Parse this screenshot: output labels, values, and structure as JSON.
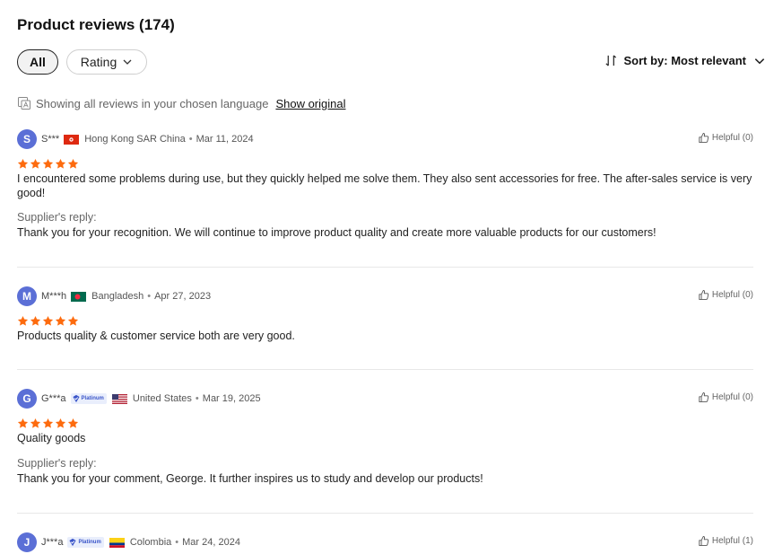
{
  "header": {
    "title": "Product reviews (174)"
  },
  "filters": {
    "all_label": "All",
    "rating_label": "Rating"
  },
  "sort": {
    "label": "Sort by: Most relevant"
  },
  "language": {
    "notice": "Showing all reviews in your chosen language",
    "show_original": "Show original"
  },
  "colors": {
    "star": "#fd6b0e",
    "avatar": "#5b6fd6",
    "text": "#222222",
    "muted": "#666666",
    "divider": "#e8e8e8"
  },
  "reviews": [
    {
      "initial": "S",
      "user": "S***",
      "country": "Hong Kong SAR China",
      "date": "Mar 11, 2024",
      "helpful": "Helpful (0)",
      "stars": 5,
      "flag": "hong-kong-flag",
      "text": "I encountered some problems during use, but they quickly helped me solve them. They also sent accessories for free. The after-sales service is very good!",
      "reply_label": "Supplier's reply:",
      "reply": "Thank you for your recognition. We will continue to improve product quality and create more valuable products for our customers!"
    },
    {
      "initial": "M",
      "user": "M***h",
      "country": "Bangladesh",
      "date": "Apr 27, 2023",
      "helpful": "Helpful (0)",
      "stars": 5,
      "flag": "bangladesh-flag",
      "text": "Products quality & customer service both are very good."
    },
    {
      "initial": "G",
      "user": "G***a",
      "badge": "Platinum",
      "country": "United States",
      "date": "Mar 19, 2025",
      "helpful": "Helpful (0)",
      "stars": 5,
      "flag": "united-states-flag",
      "text": "Quality goods",
      "reply_label": "Supplier's reply:",
      "reply": "Thank you for your comment, George. It further inspires us to study and develop our products!"
    },
    {
      "initial": "J",
      "user": "J***a",
      "badge": "Platinum",
      "country": "Colombia",
      "date": "Mar 24, 2024",
      "helpful": "Helpful (1)",
      "flag": "colombia-flag"
    }
  ]
}
